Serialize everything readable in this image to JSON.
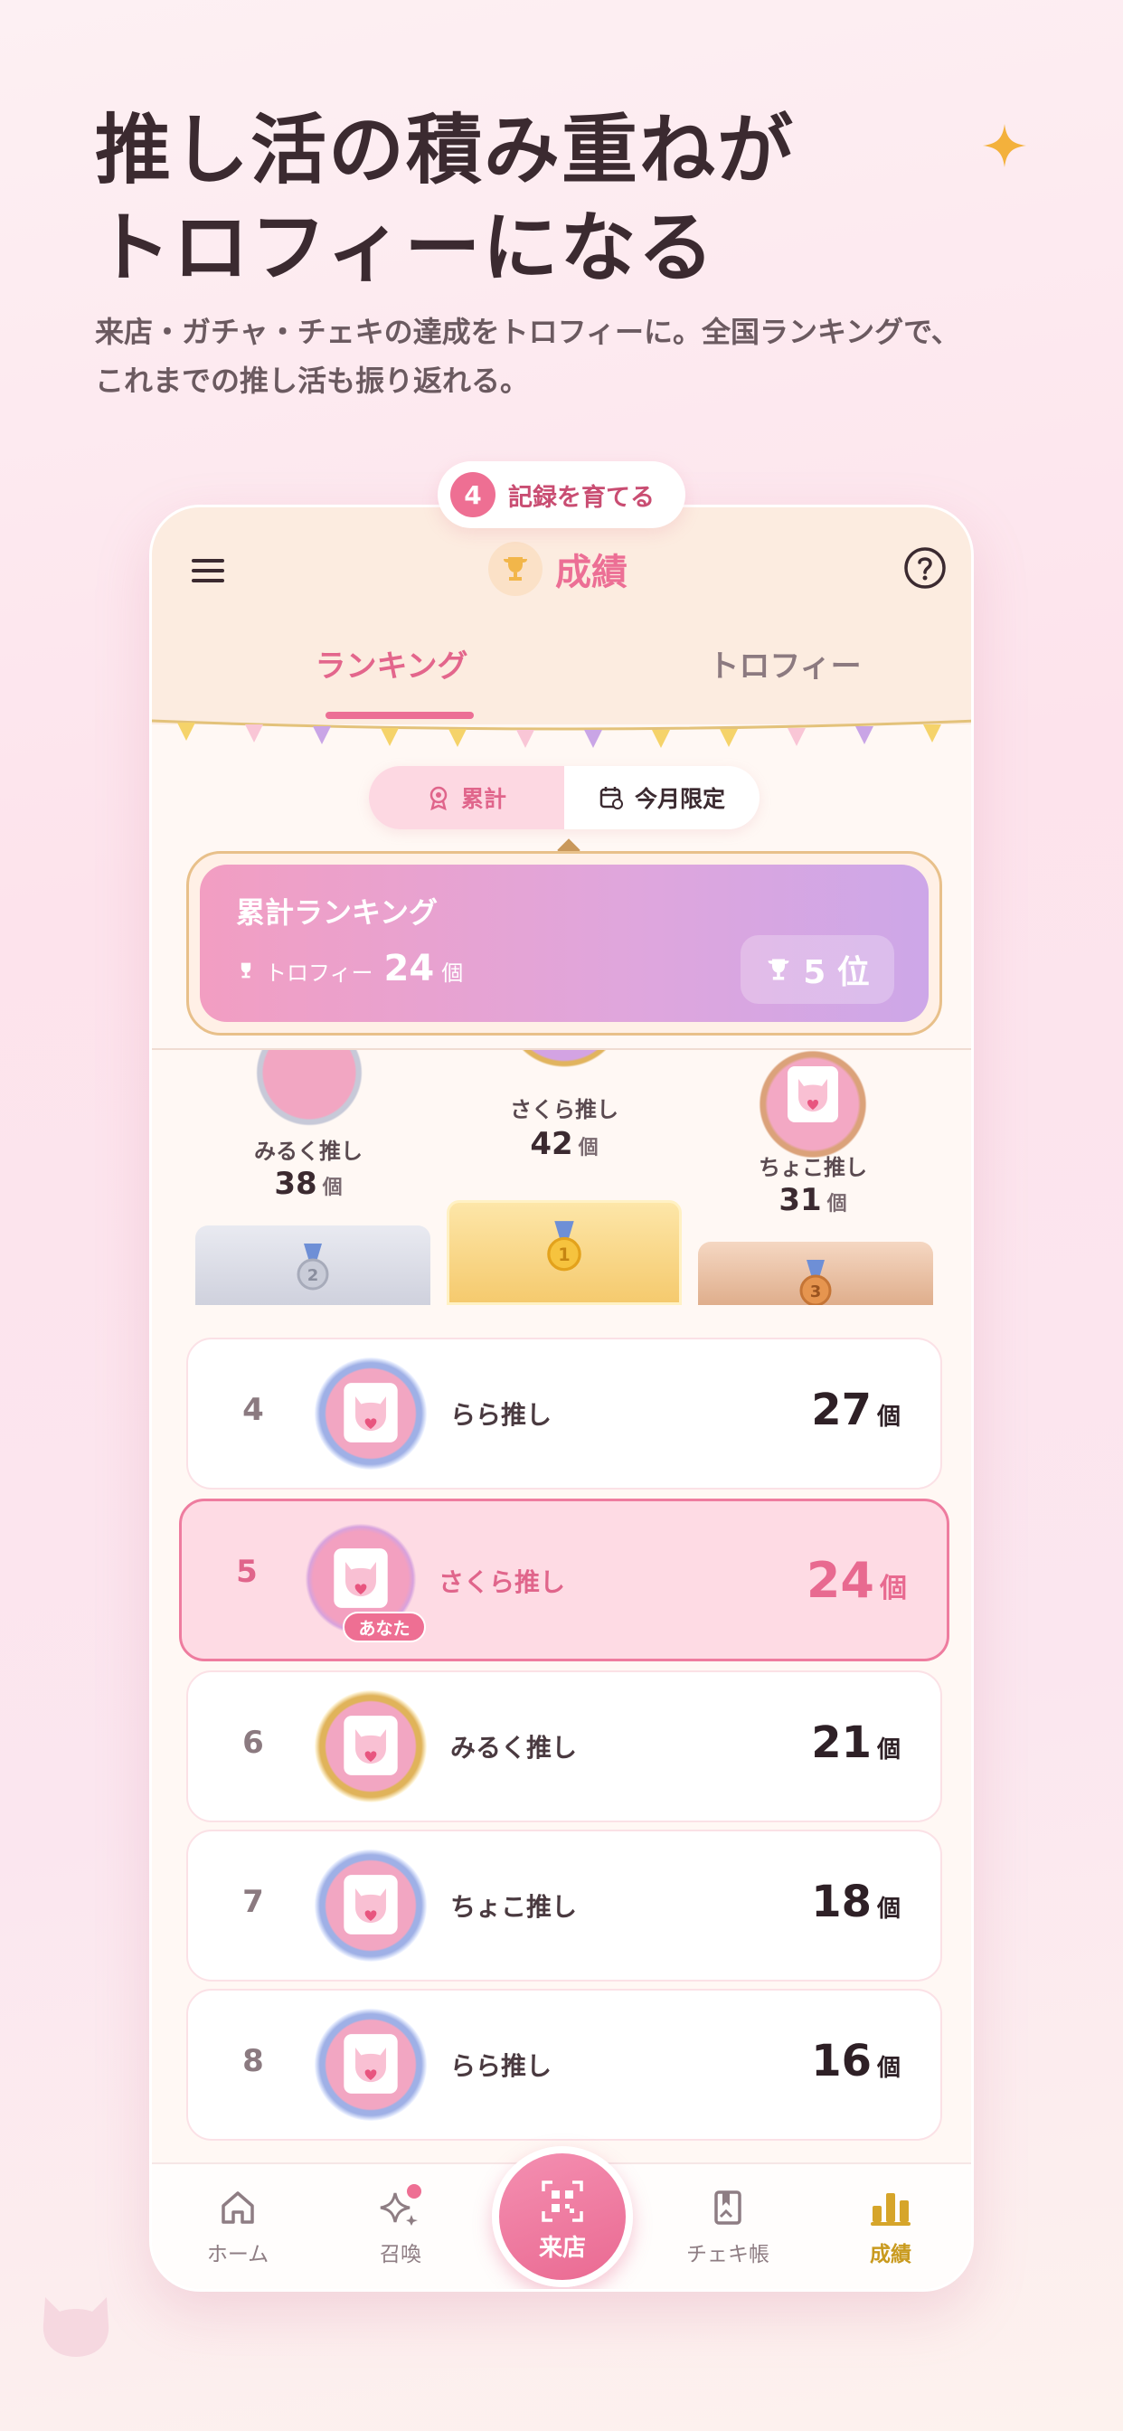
{
  "headline": {
    "line1": "推し活の積み重ねが",
    "line2": "トロフィーになる",
    "sub_line1": "来店・ガチャ・チェキの達成をトロフィーに。全国ランキングで、",
    "sub_line2": "これまでの推し活も振り返れる。"
  },
  "step": {
    "number": "4",
    "label": "記録を育てる"
  },
  "appbar": {
    "title": "成績"
  },
  "tabs": [
    {
      "label": "ランキング",
      "active": true
    },
    {
      "label": "トロフィー",
      "active": false
    }
  ],
  "segment": {
    "cumulative": "累計",
    "monthly": "今月限定"
  },
  "summary": {
    "title": "累計ランキング",
    "trophy_label": "トロフィー",
    "count": "24",
    "unit": "個",
    "rank": "5 位"
  },
  "podium": [
    {
      "place": "2",
      "name": "みるく推し",
      "count": "38",
      "unit": "個"
    },
    {
      "place": "1",
      "name": "さくら推し",
      "count": "42",
      "unit": "個"
    },
    {
      "place": "3",
      "name": "ちょこ推し",
      "count": "31",
      "unit": "個"
    }
  ],
  "ranking": [
    {
      "rank": "4",
      "name": "らら推し",
      "count": "27",
      "unit": "個",
      "me": false
    },
    {
      "rank": "5",
      "name": "さくら推し",
      "count": "24",
      "unit": "個",
      "me": true,
      "tag": "あなた"
    },
    {
      "rank": "6",
      "name": "みるく推し",
      "count": "21",
      "unit": "個",
      "me": false
    },
    {
      "rank": "7",
      "name": "ちょこ推し",
      "count": "18",
      "unit": "個",
      "me": false
    },
    {
      "rank": "8",
      "name": "らら推し",
      "count": "16",
      "unit": "個",
      "me": false
    }
  ],
  "nav": {
    "home": "ホーム",
    "summon": "召喚",
    "visit": "来店",
    "cheki": "チェキ帳",
    "results": "成績"
  },
  "colors": {
    "accent": "#ec6f95",
    "gold": "#c99a1e",
    "silver": "#d5d7e0",
    "bronze": "#e4b38f"
  }
}
